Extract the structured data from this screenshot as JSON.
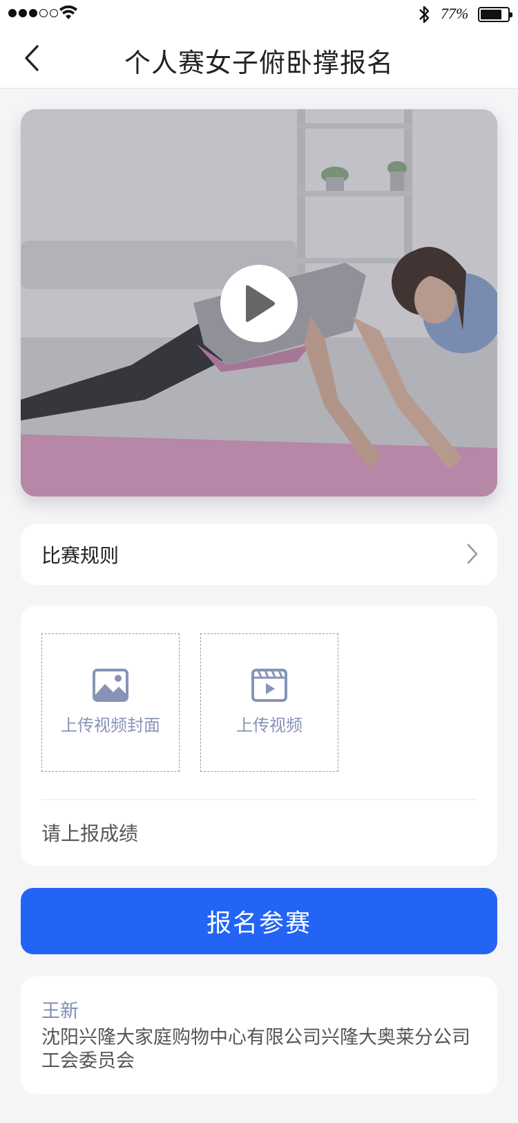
{
  "status_bar": {
    "battery_percent": "77%",
    "signal_icon": "signal-dots-icon",
    "wifi_icon": "wifi-icon",
    "bluetooth_icon": "bluetooth-icon",
    "battery_icon": "battery-icon"
  },
  "nav": {
    "title": "个人赛女子俯卧撑报名",
    "back_icon": "chevron-left-icon"
  },
  "video": {
    "play_icon": "play-icon"
  },
  "rules": {
    "label": "比赛规则",
    "chevron_icon": "chevron-right-icon"
  },
  "upload": {
    "cover_label": "上传视频封面",
    "cover_icon": "image-icon",
    "video_label": "上传视频",
    "video_icon": "video-clapper-icon",
    "score_placeholder": "请上报成绩"
  },
  "submit_label": "报名参赛",
  "info": {
    "name": "王新",
    "organization": "沈阳兴隆大家庭购物中心有限公司兴隆大奥莱分公司工会委员会"
  },
  "colors": {
    "primary": "#2364f5",
    "accent_text": "#7f8eb6",
    "background": "#f5f5f7"
  }
}
